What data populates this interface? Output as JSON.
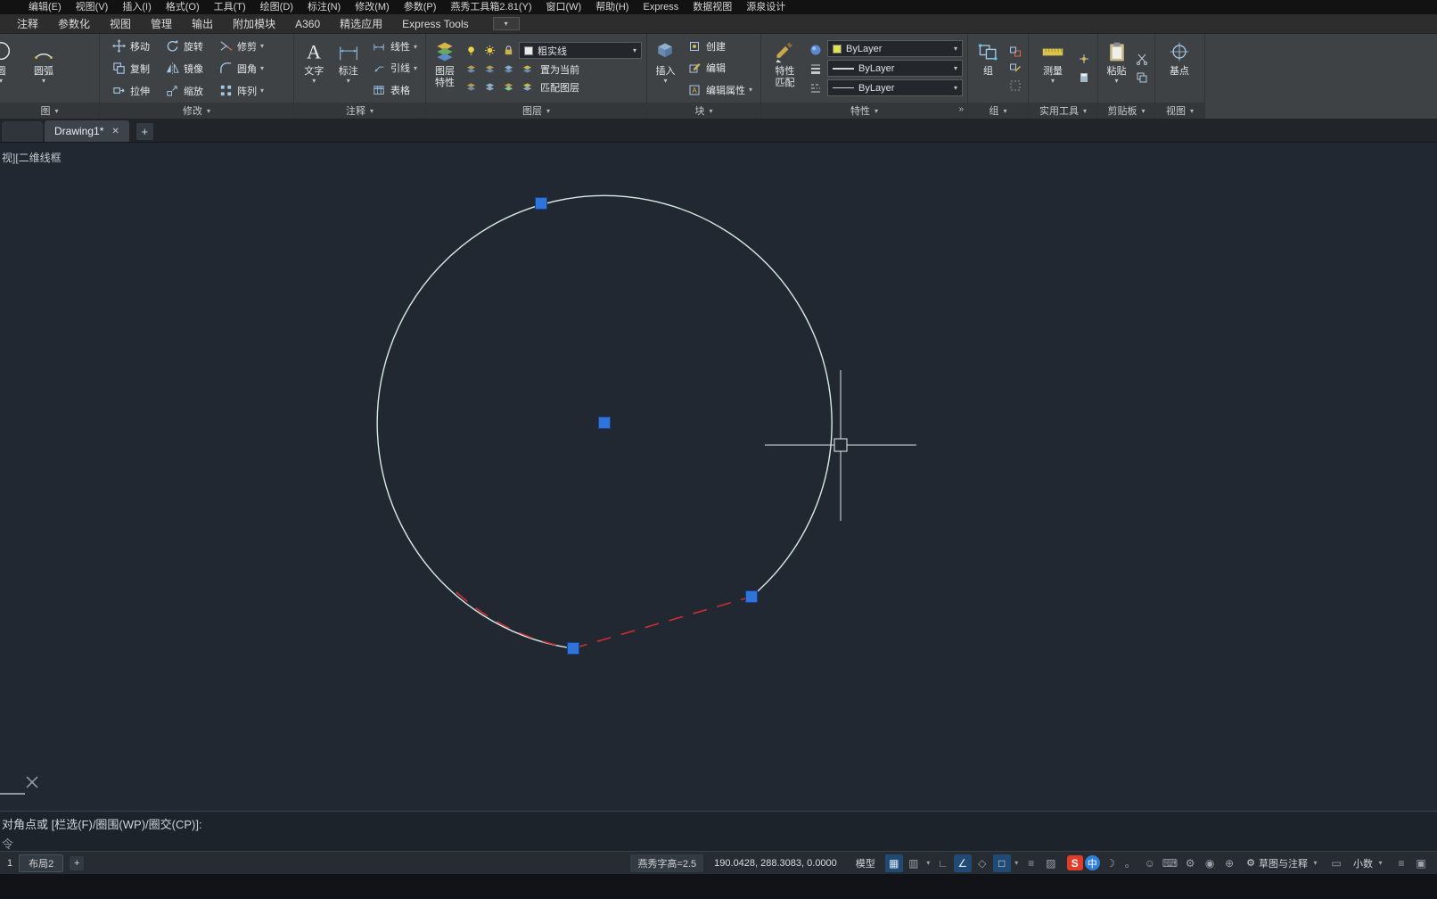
{
  "menubar": {
    "items": [
      "编辑(E)",
      "视图(V)",
      "插入(I)",
      "格式(O)",
      "工具(T)",
      "绘图(D)",
      "标注(N)",
      "修改(M)",
      "参数(P)",
      "燕秀工具箱2.81(Y)",
      "窗口(W)",
      "帮助(H)",
      "Express",
      "数据视图",
      "源泉设计"
    ]
  },
  "ribbon_tabs": {
    "items": [
      "注释",
      "参数化",
      "视图",
      "管理",
      "输出",
      "附加模块",
      "A360",
      "精选应用",
      "Express Tools"
    ]
  },
  "ribbon": {
    "draw": {
      "label": "图",
      "circle": "圆",
      "arc": "圆弧"
    },
    "modify": {
      "label": "修改",
      "move": "移动",
      "copy": "复制",
      "stretch": "拉伸",
      "rotate": "旋转",
      "mirror": "镜像",
      "scale": "缩放",
      "trim": "修剪",
      "fillet": "圆角",
      "array": "阵列"
    },
    "annotate": {
      "label": "注释",
      "text": "文字",
      "dim": "标注",
      "linear": "线性",
      "leader": "引线",
      "table": "表格"
    },
    "layers": {
      "label": "图层",
      "props_line1": "图层",
      "props_line2": "特性",
      "current_layer": "粗实线",
      "set_current": "置为当前",
      "match_layer": "匹配图层"
    },
    "block": {
      "label": "块",
      "insert": "插入",
      "create": "创建",
      "edit": "编辑",
      "edit_attr": "编辑属性"
    },
    "properties": {
      "label": "特性",
      "match_line1": "特性",
      "match_line2": "匹配",
      "color": "ByLayer",
      "lineweight": "ByLayer",
      "linetype": "ByLayer"
    },
    "group": {
      "label": "组",
      "group": "组"
    },
    "utilities": {
      "label": "实用工具",
      "measure": "测量"
    },
    "clipboard": {
      "label": "剪贴板",
      "paste": "粘贴"
    },
    "view": {
      "label": "视图",
      "base": "基点"
    }
  },
  "file_tabs": {
    "drawing": "Drawing1*",
    "new_tab": "+"
  },
  "canvas": {
    "viewport_label": "视][二维线框"
  },
  "command": {
    "prompt": "对角点或 [栏选(F)/圈围(WP)/圈交(CP)]:",
    "history": "令"
  },
  "statusbar": {
    "layout_partial": "1",
    "layout_tab": "布局2",
    "new_layout": "+",
    "yanxiu": "燕秀字高=2.5",
    "coords": "190.0428, 288.3083, 0.0000",
    "model": "模型",
    "ime_sogou": "S",
    "ime_mode": "中",
    "workspace": "草图与注释",
    "units": "小数"
  },
  "icons": {
    "grid": "▦",
    "snap": "▥",
    "ortho": "∟",
    "polar": "∠",
    "isodraft": "◇",
    "osnap": "□",
    "lineweight": "≡",
    "transparency": "▨",
    "dropdown": "▾",
    "launcher": "»",
    "moon": "☽",
    "punct": "。",
    "emoji": "☺",
    "keyboard": "⌨",
    "gear": "⚙",
    "annot_visibility": "◉",
    "annot_scale": "⊕",
    "hardware": "▭",
    "clean_screen": "▣",
    "menu": "≡",
    "close": "✕"
  },
  "colors": {
    "grip_blue": "#3073d9",
    "circle_stroke": "#d8ebe6",
    "red_dash": "#cc2f2f",
    "canvas_bg": "#212831",
    "active_status": "#204a73"
  }
}
